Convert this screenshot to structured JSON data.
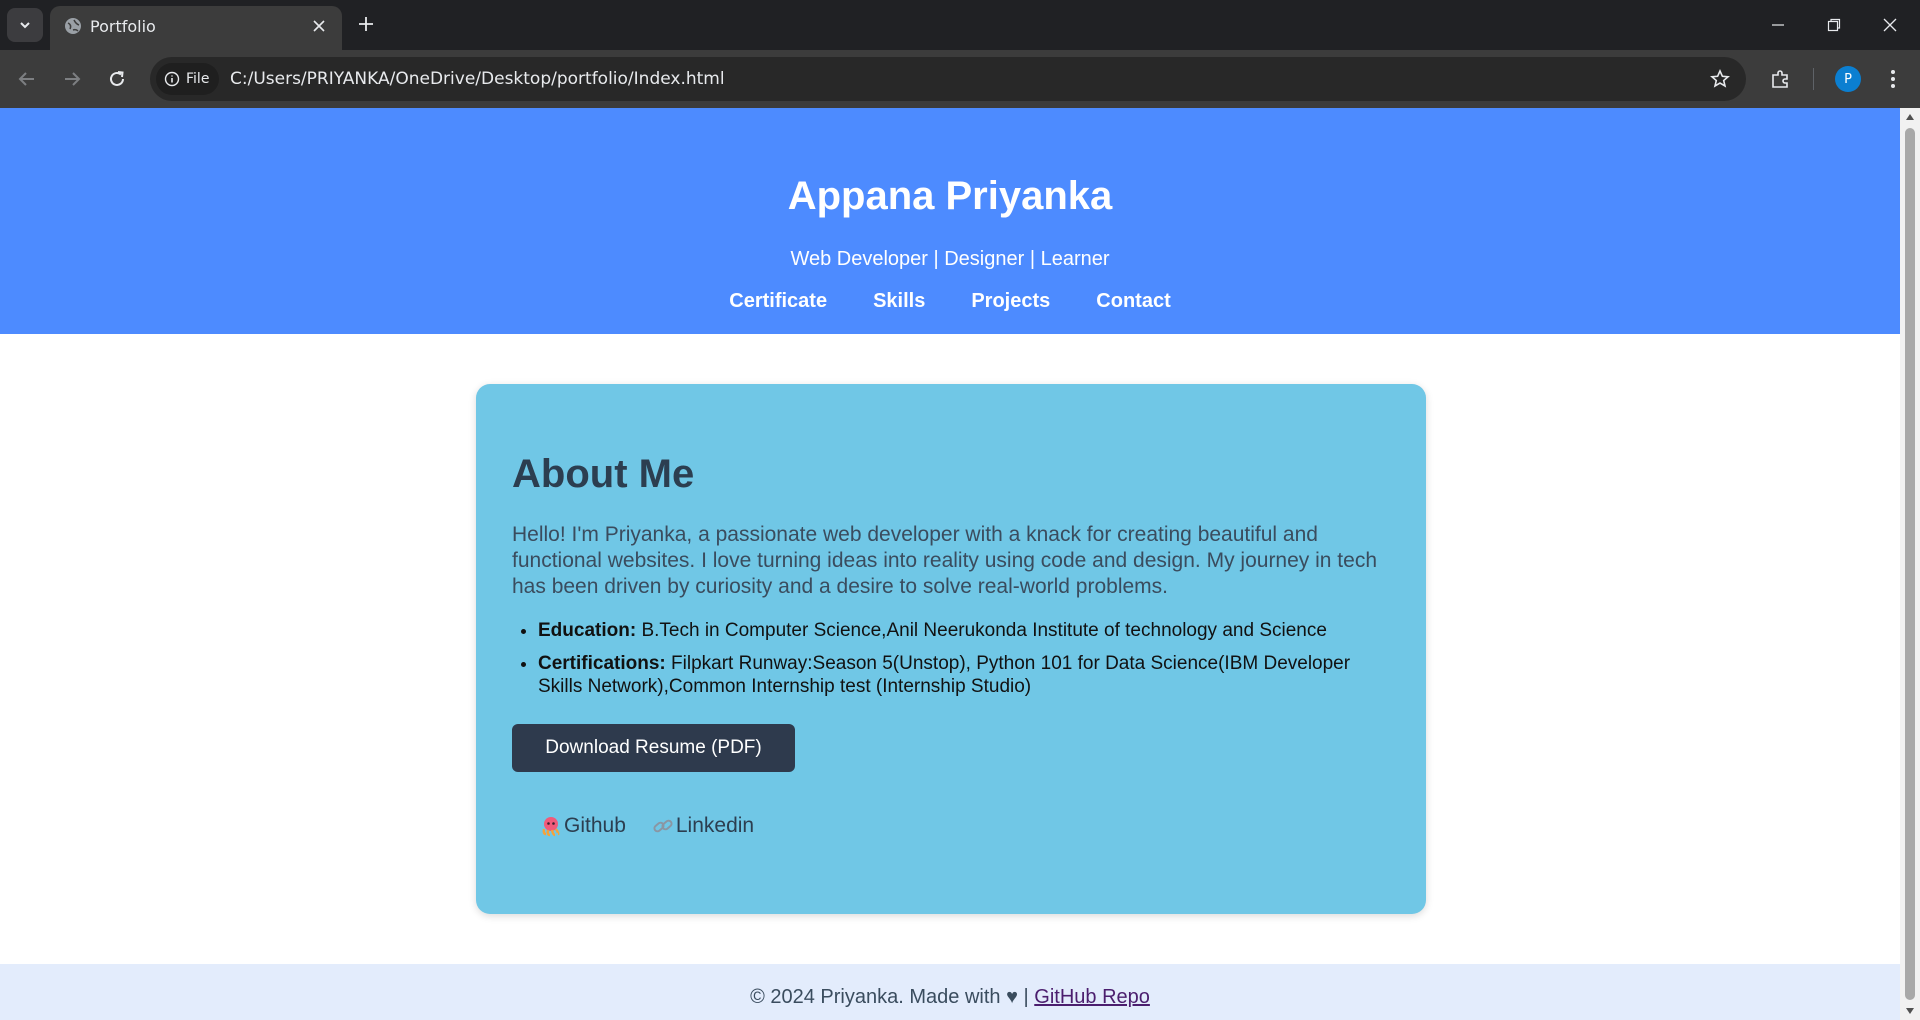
{
  "browser": {
    "tab_title": "Portfolio",
    "address_chip": "File",
    "url": "C:/Users/PRIYANKA/OneDrive/Desktop/portfolio/Index.html",
    "profile_initial": "P"
  },
  "header": {
    "name": "Appana Priyanka",
    "tagline": "Web Developer | Designer | Learner",
    "nav": [
      "Certificate",
      "Skills",
      "Projects",
      "Contact"
    ]
  },
  "about": {
    "heading": "About Me",
    "intro": "Hello! I'm Priyanka, a passionate web developer with a knack for creating beautiful and functional websites. I love turning ideas into reality using code and design. My journey in tech has been driven by curiosity and a desire to solve real-world problems.",
    "education_label": "Education:",
    "education_value": "B.Tech in Computer Science,Anil Neerukonda Institute of technology and Science",
    "certifications_label": "Certifications:",
    "certifications_value": "Filpkart Runway:Season 5(Unstop), Python 101 for Data Science(IBM Developer Skills Network),Common Internship test (Internship Studio)",
    "resume_button": "Download Resume (PDF)",
    "github_link": "Github",
    "linkedin_link": "Linkedin"
  },
  "footer": {
    "text": "© 2024 Priyanka. Made with ♥ |",
    "repo_link": "GitHub Repo"
  },
  "colors": {
    "header_bg": "#4d8bff",
    "card_bg": "#70c7e6",
    "button_bg": "#2e3a4d",
    "footer_bg": "#e3ecfc"
  }
}
